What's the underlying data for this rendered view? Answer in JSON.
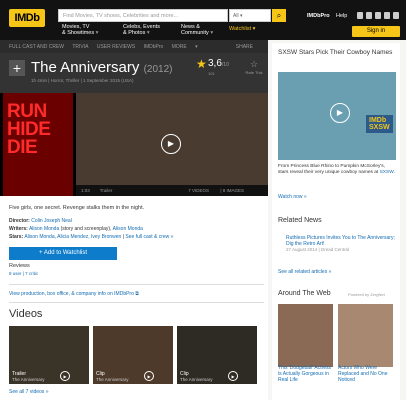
{
  "brand": {
    "logo": "IMDb",
    "accent": "#f5c518",
    "link": "#136cb2"
  },
  "header": {
    "search_placeholder": "Find Movies, TV shows, Celebrities and more...",
    "search_scope": "All",
    "nav": [
      {
        "label": "Movies, TV\n& Showtimes"
      },
      {
        "label": "Celebs, Events\n& Photos"
      },
      {
        "label": "News &\nCommunity"
      }
    ],
    "watchlist": "Watchlist",
    "imdbpro": "IMDbPro",
    "help": "Help",
    "signin": "Sign in"
  },
  "subnav": {
    "items": [
      "FULL CAST AND CREW",
      "TRIVIA",
      "USER REVIEWS",
      "IMDbPro",
      "MORE"
    ],
    "share": "SHARE"
  },
  "title": {
    "name": "The Anniversary",
    "year": "(2012)",
    "meta": "1h 4min  |  Horror, Thriller  |  1 September 2015 (USA)",
    "rating": "3,6",
    "rating_max": "/10",
    "votes": "101",
    "rate_this": "Rate This"
  },
  "media": {
    "poster_text": "RUN\nHIDE\nDIE",
    "duration": "1:03",
    "kind": "Trailer",
    "videos": "7 VIDEOS",
    "images": "8 IMAGES"
  },
  "details": {
    "summary": "Five girls, one secret. Revenge stalks them in the night.",
    "director_label": "Director:",
    "director": "Colin Joseph Neal",
    "writers_label": "Writers:",
    "writers": "Alison Monda",
    "writers_note": "(story and screenplay),",
    "writers2": "Alison Monda",
    "stars_label": "Stars:",
    "stars": "Alison Monda, Alicia Mendez, Ivey Bronwen",
    "full_cast": "See full cast & crew »",
    "add_watchlist": "+ Add to Watchlist",
    "reviews_label": "Reviews",
    "reviews_counts": "8 user  |  7 critic",
    "pro_link": "View production, box office, & company info on IMDbPro"
  },
  "videos": {
    "heading": "Videos",
    "items": [
      {
        "type": "Trailer",
        "title": "The Anniversary"
      },
      {
        "type": "Clip",
        "title": "The Anniversary"
      },
      {
        "type": "Clip",
        "title": "The Anniversary"
      }
    ],
    "see_all": "See all 7 videos »"
  },
  "sidebar": {
    "feature_heading": "SXSW Stars Pick Their Cowboy Names",
    "feature_text": "From Princess Blue Rhino to Pumpkin McSorley's, stars reveal their very unique cowboy names at",
    "feature_link": "SXSW.",
    "watch_now": "Watch now »",
    "badge": "IMDb\nSXSW",
    "related_heading": "Related News",
    "news_title": "Ruthless Pictures Invites You to The Anniversary; Dig the Retro Art!",
    "news_date": "27 August 2014  |  Dread Central",
    "see_all_related": "See all related articles »",
    "web_heading": "Around The Web",
    "powered": "Powered by ZergNet",
    "web_items": [
      {
        "text": "This 'Dodgeball' Actress is Actually Gorgeous in Real Life"
      },
      {
        "text": "Actors Who Were Replaced and No One Noticed"
      }
    ]
  }
}
